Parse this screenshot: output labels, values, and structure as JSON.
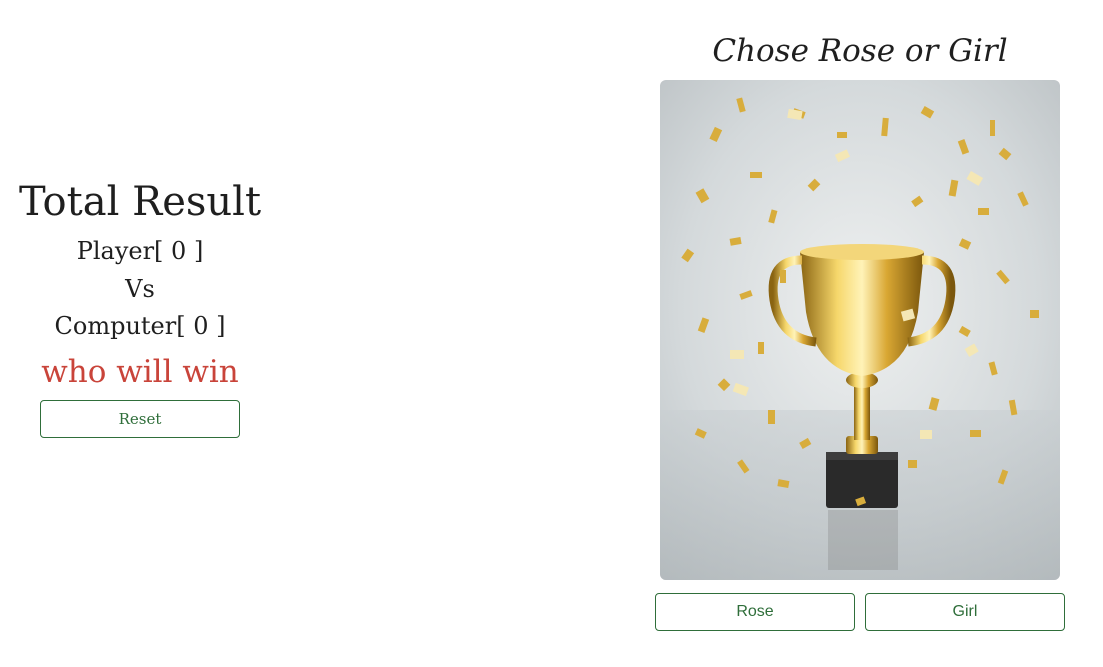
{
  "scoreboard": {
    "title": "Total Result",
    "player_label": "Player[ 0 ]",
    "vs_label": "Vs",
    "computer_label": "Computer[ 0 ]",
    "status": "who will win",
    "reset_label": "Reset"
  },
  "game": {
    "heading": "Chose Rose or Girl",
    "image": "trophy-with-confetti",
    "choices": [
      {
        "label": "Rose"
      },
      {
        "label": "Girl"
      }
    ]
  },
  "colors": {
    "accent": "#2f6e3a",
    "status": "#c9443a",
    "text": "#1f1f1f"
  }
}
